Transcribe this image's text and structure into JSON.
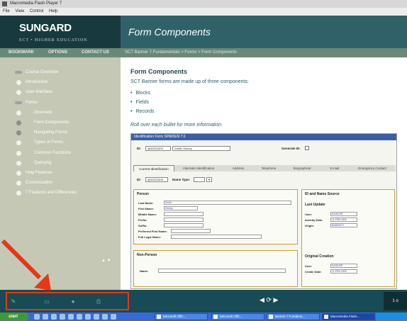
{
  "window": {
    "title": "Macromedia Flash Player 7",
    "menu": [
      "File",
      "View",
      "Control",
      "Help"
    ]
  },
  "header": {
    "logo": "SUNGARD",
    "tagline": "SCT • HIGHER EDUCATION",
    "banner_title": "Form Components"
  },
  "nav": {
    "links": [
      "BOOKMARK",
      "OPTIONS",
      "CONTACT US"
    ],
    "breadcrumb": "SCT Banner 7 Fundamentals  >  Forms  >  Form Components"
  },
  "sidebar": {
    "items": [
      {
        "label": "Course Overview",
        "marker": "tri",
        "indent": 0
      },
      {
        "label": "Introduction",
        "marker": "dot",
        "indent": 0
      },
      {
        "label": "User Interface",
        "marker": "dot",
        "indent": 0
      },
      {
        "label": "Forms",
        "marker": "tri",
        "indent": 0
      },
      {
        "label": "Overview",
        "marker": "dot",
        "indent": 1
      },
      {
        "label": "Form Components",
        "marker": "dark",
        "indent": 1
      },
      {
        "label": "Navigating Forms",
        "marker": "dark",
        "indent": 1
      },
      {
        "label": "Types of Forms",
        "marker": "dot",
        "indent": 1
      },
      {
        "label": "Common Functions",
        "marker": "dot",
        "indent": 1
      },
      {
        "label": "Querying",
        "marker": "dot",
        "indent": 1
      },
      {
        "label": "Help Features",
        "marker": "dot",
        "indent": 0
      },
      {
        "label": "Customization",
        "marker": "dot",
        "indent": 0
      },
      {
        "label": "7 Features and Differences",
        "marker": "dot",
        "indent": 0
      }
    ],
    "scroll_arrows": "▲ ▼"
  },
  "content": {
    "title": "Form Components",
    "intro": "SCT Banner forms are made up of three components:",
    "bullets": [
      "Blocks",
      "Fields",
      "Records"
    ],
    "rollover": "Roll over each bullet for more information."
  },
  "form": {
    "title": "Identification Form  SPAIDEN  7.0",
    "id_label": "ID:",
    "id_value": "@00021509",
    "name_value": "Smith, Kimmy",
    "generate_label": "Generate ID:",
    "tabs": [
      "Current Identification",
      "Alternate Identification",
      "Address",
      "Telephone",
      "Biographical",
      "E-mail",
      "Emergency Contact"
    ],
    "row2_id_label": "ID:",
    "row2_id_value": "@00021509",
    "name_type_label": "Name Type:",
    "person_title": "Person",
    "person_fields": [
      "Last Name:",
      "First Name:",
      "Middle Name:",
      "Prefix:",
      "Suffix:",
      "Preferred First Name:",
      "Full Legal Name:"
    ],
    "last_name_value": "Smith",
    "first_name_value": "Kimmy",
    "nonperson_title": "Non-Person",
    "nonperson_name_label": "Name:",
    "source_title": "ID and Name Source",
    "last_update_title": "Last Update",
    "update_labels": [
      "User:",
      "Activity Date:",
      "Origin:"
    ],
    "update_values": [
      "SAISUSR",
      "11-FEB-2005",
      "BANINST1"
    ],
    "orig_title": "Original Creation",
    "orig_labels": [
      "User:",
      "Create Date:"
    ],
    "orig_values": [
      "SAISUSR",
      "11-FEB-2005"
    ]
  },
  "bottom": {
    "tools": [
      "pencil",
      "note",
      "audio",
      "print"
    ],
    "pager": "◀ ⟳ ▶",
    "right_label": "1 o"
  },
  "taskbar": {
    "start": "start",
    "tasks": [
      "Microsoft Offic...",
      "Microsoft Offic...",
      "Banner 7 Fundame...",
      "Macromedia Flash..."
    ]
  },
  "colors": {
    "header_dark": "#183a3e",
    "banner": "#2e6268",
    "sidebar": "#c4c8b4",
    "nav_strip": "#6a8878",
    "annotation": "#e63814"
  }
}
